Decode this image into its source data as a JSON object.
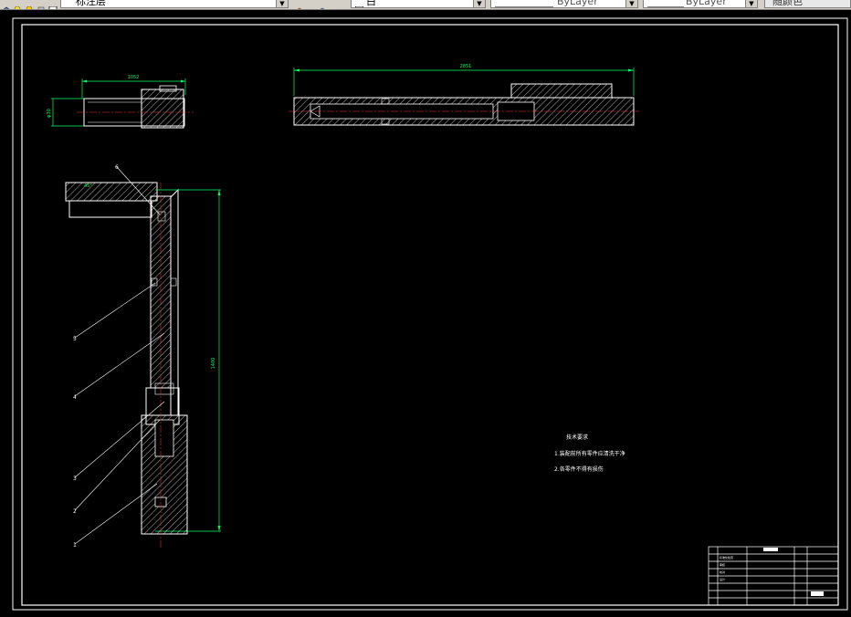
{
  "toolbar": {
    "layer_value": "标注层",
    "color_value": "白",
    "linetype_value": "ByLayer",
    "lineweight_value": "ByLayer",
    "plotstyle_value": "随颜色"
  },
  "drawing": {
    "dim_top_left": "1052",
    "dim_top_left_height": "φ30",
    "dim_top_right": "2851",
    "dim_vertical": "1400",
    "dim_angle": "45°",
    "balloons": [
      "6",
      "5",
      "4",
      "3",
      "2",
      "1"
    ],
    "tech_req_title": "技术要求",
    "tech_req_lines": [
      "1.装配前所有零件应清洗干净",
      "2.各零件不得有损伤"
    ],
    "title_block_rows": [
      "标准化检查",
      "审核",
      "校对",
      "设计"
    ]
  }
}
